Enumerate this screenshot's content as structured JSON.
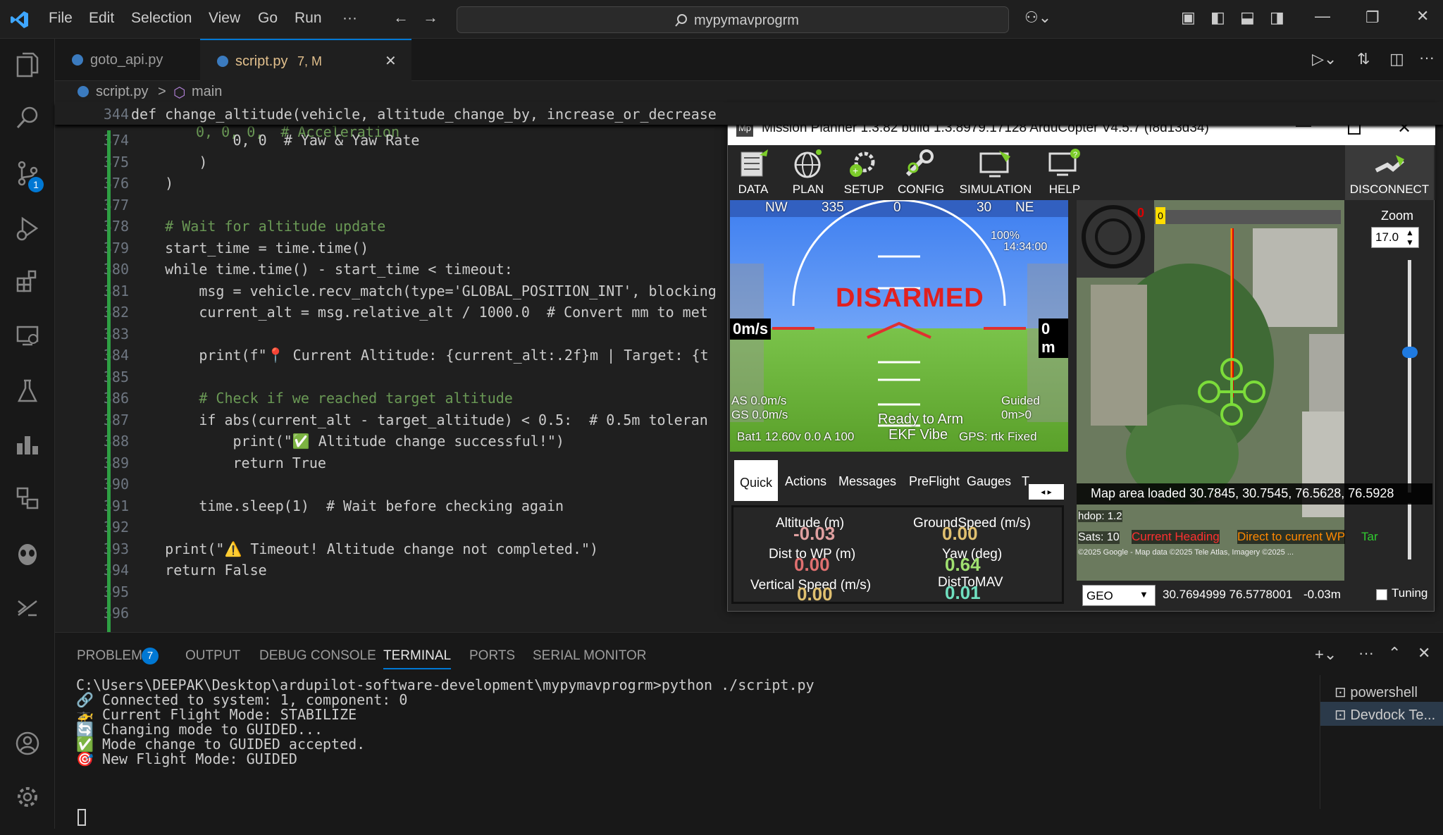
{
  "titlebar": {
    "menus": [
      "File",
      "Edit",
      "Selection",
      "View",
      "Go",
      "Run",
      "···"
    ],
    "search": "mypymavprogrm"
  },
  "activity": {
    "scm_badge": "1"
  },
  "tabs": [
    {
      "label": "goto_api.py",
      "suffix": ""
    },
    {
      "label": "script.py",
      "suffix": "7, M"
    }
  ],
  "breadcrumb": {
    "file": "script.py",
    "sep": ">",
    "symbol": "main"
  },
  "editor": {
    "sticky": {
      "num": "344",
      "text": "def change_altitude(vehicle, altitude_change_by, increase_or_decrease"
    },
    "lines": [
      {
        "num": "374",
        "text": "            0, 0  # Yaw & Yaw Rate"
      },
      {
        "num": "375",
        "text": "        )"
      },
      {
        "num": "376",
        "text": "    )"
      },
      {
        "num": "377",
        "text": ""
      },
      {
        "num": "378",
        "text": "    # Wait for altitude update"
      },
      {
        "num": "379",
        "text": "    start_time = time.time()"
      },
      {
        "num": "380",
        "text": "    while time.time() - start_time < timeout:"
      },
      {
        "num": "381",
        "text": "        msg = vehicle.recv_match(type='GLOBAL_POSITION_INT', blocking"
      },
      {
        "num": "382",
        "text": "        current_alt = msg.relative_alt / 1000.0  # Convert mm to met"
      },
      {
        "num": "383",
        "text": ""
      },
      {
        "num": "384",
        "text": "        print(f\"📍 Current Altitude: {current_alt:.2f}m | Target: {t"
      },
      {
        "num": "385",
        "text": ""
      },
      {
        "num": "386",
        "text": "        # Check if we reached target altitude"
      },
      {
        "num": "387",
        "text": "        if abs(current_alt - target_altitude) < 0.5:  # 0.5m toleran"
      },
      {
        "num": "388",
        "text": "            print(\"✅ Altitude change successful!\")"
      },
      {
        "num": "389",
        "text": "            return True"
      },
      {
        "num": "390",
        "text": ""
      },
      {
        "num": "391",
        "text": "        time.sleep(1)  # Wait before checking again"
      },
      {
        "num": "392",
        "text": ""
      },
      {
        "num": "393",
        "text": "    print(\"⚠️ Timeout! Altitude change not completed.\")"
      },
      {
        "num": "394",
        "text": "    return False"
      },
      {
        "num": "395",
        "text": ""
      },
      {
        "num": "396",
        "text": ""
      }
    ]
  },
  "panel": {
    "tabs": [
      "PROBLEMS",
      "OUTPUT",
      "DEBUG CONSOLE",
      "TERMINAL",
      "PORTS",
      "SERIAL MONITOR"
    ],
    "problems_count": "7",
    "terminal_lines": [
      "C:\\Users\\DEEPAK\\Desktop\\ardupilot-software-development\\mypymavprogrm>python ./script.py",
      "🔗 Connected to system: 1, component: 0",
      "🚁 Current Flight Mode: STABILIZE",
      "🔄 Changing mode to GUIDED...",
      "✅ Mode change to GUIDED accepted.",
      "🎯 New Flight Mode: GUIDED"
    ],
    "terminals": [
      "powershell",
      "Devdock Te..."
    ]
  },
  "mp": {
    "title": "Mission Planner 1.3.82 build 1.3.8979.17128 ArduCopter V4.5.7 (f8d13d34)",
    "toolbar": [
      "DATA",
      "PLAN",
      "SETUP",
      "CONFIG",
      "SIMULATION",
      "HELP"
    ],
    "disconnect": "DISCONNECT",
    "hud": {
      "status": "DISARMED",
      "speed": "0m/s",
      "alt": "0 m",
      "as": "AS 0.0m/s",
      "gs": "GS 0.0m/s",
      "mode": "Guided",
      "dist": "0m>0",
      "ready": "Ready to Arm",
      "ekf": "EKF Vibe",
      "gps": "GPS: rtk Fixed",
      "bat": "Bat1 12.60v 0.0 A 100",
      "time": "14:34:00",
      "pct": "100%",
      "compass": [
        "NW",
        "335",
        "0",
        "30",
        "NE"
      ]
    },
    "tabs": [
      "Quick",
      "Actions",
      "Messages",
      "PreFlight",
      "Gauges",
      "T"
    ],
    "quick": [
      {
        "label": "Altitude (m)",
        "value": "-0.03",
        "color": "#e0a0a0"
      },
      {
        "label": "GroundSpeed (m/s)",
        "value": "0.00",
        "color": "#e0c070"
      },
      {
        "label": "Dist to WP (m)",
        "value": "0.00",
        "color": "#e07070"
      },
      {
        "label": "Yaw (deg)",
        "value": "0.64",
        "color": "#a0e070"
      },
      {
        "label": "Vertical Speed (m/s)",
        "value": "0.00",
        "color": "#e0c070"
      },
      {
        "label": "DistToMAV",
        "value": "0.01",
        "color": "#70e0c0"
      }
    ],
    "map": {
      "zoom_label": "Zoom",
      "zoom_value": "17.0",
      "loaded": "Map area loaded 30.7845, 30.7545, 76.5628, 76.5928",
      "hdop": "hdop: 1.2",
      "sats": "Sats: 10",
      "legend_heading": "Current Heading",
      "legend_wp": "Direct to current WP",
      "legend_tar": "Tar",
      "copyright": "©2025 Google - Map data ©2025 Tele Atlas, Imagery ©2025 ...",
      "coord_mode": "GEO",
      "coords": "30.7694999 76.5778001",
      "alt": "-0.03m",
      "tuning": "Tuning",
      "red_zero": "0",
      "slider_val": "0"
    }
  }
}
